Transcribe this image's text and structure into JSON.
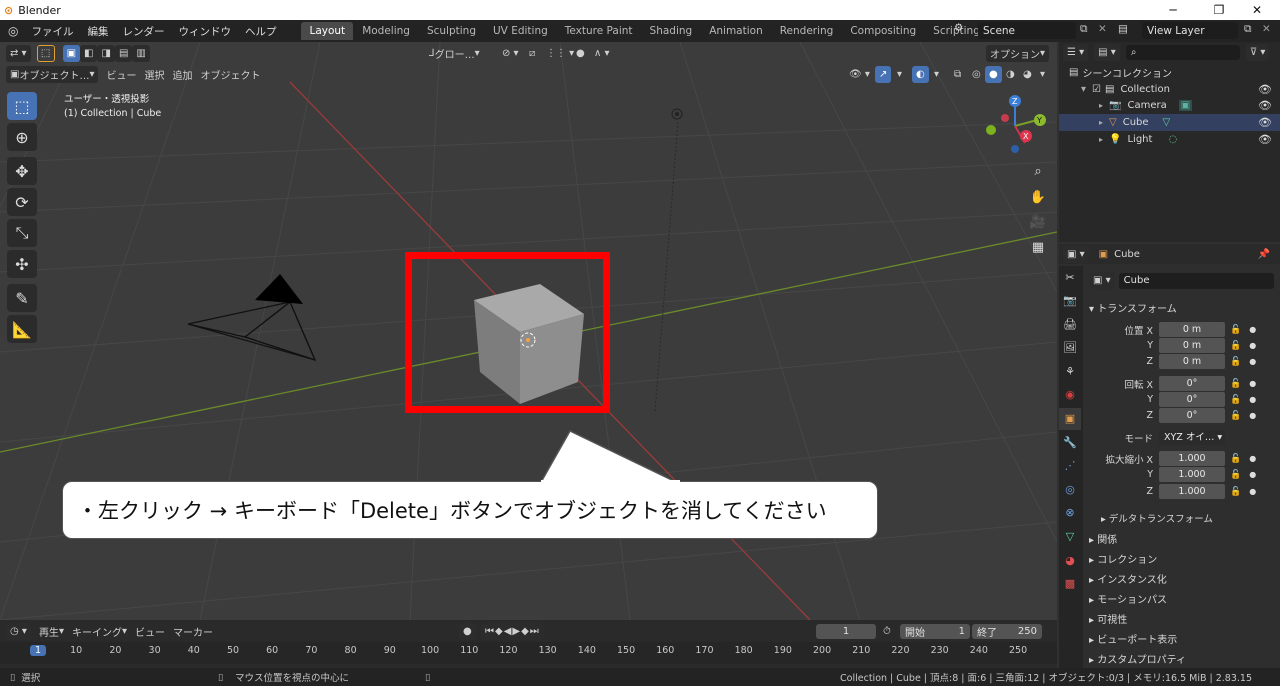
{
  "window": {
    "title": "Blender",
    "minimize": "─",
    "maximize": "❐",
    "close": "✕"
  },
  "menus": [
    "ファイル",
    "編集",
    "レンダー",
    "ウィンドウ",
    "ヘルプ"
  ],
  "workspaces": [
    "Layout",
    "Modeling",
    "Sculpting",
    "UV Editing",
    "Texture Paint",
    "Shading",
    "Animation",
    "Rendering",
    "Compositing",
    "Scripting"
  ],
  "scene": {
    "name": "Scene",
    "view_layer": "View Layer"
  },
  "viewport": {
    "transform_orientation": "グロー…",
    "options_label": "オプション",
    "mode": "オブジェクト…",
    "menu": [
      "ビュー",
      "選択",
      "追加",
      "オブジェクト"
    ],
    "view_name": "ユーザー・透視投影",
    "context": "(1) Collection | Cube",
    "gizmo_labels": {
      "z": "Z",
      "y": "Y",
      "x": "X"
    }
  },
  "callout": {
    "text": "・左クリック → キーボード「Delete」ボタンでオブジェクトを消してください"
  },
  "outliner": {
    "root": "シーンコレクション",
    "items": [
      {
        "name": "Collection"
      },
      {
        "name": "Camera"
      },
      {
        "name": "Cube"
      },
      {
        "name": "Light"
      }
    ]
  },
  "properties": {
    "object_name": "Cube",
    "datablock": "Cube",
    "transform_header": "トランスフォーム",
    "location": {
      "label": "位置 X",
      "x": "0 m",
      "y": "0 m",
      "z": "0 m"
    },
    "rotation": {
      "label": "回転 X",
      "x": "0°",
      "y": "0°",
      "z": "0°"
    },
    "mode": {
      "label": "モード",
      "value": "XYZ オイ…"
    },
    "scale": {
      "label": "拡大縮小 X",
      "x": "1.000",
      "y": "1.000",
      "z": "1.000"
    },
    "axis_y": "Y",
    "axis_z": "Z",
    "delta": "デルタトランスフォーム",
    "sections": [
      "関係",
      "コレクション",
      "インスタンス化",
      "モーションパス",
      "可視性",
      "ビューポート表示",
      "カスタムプロパティ"
    ]
  },
  "timeline": {
    "menus": [
      "再生",
      "キーイング",
      "ビュー",
      "マーカー"
    ],
    "current_frame": "1",
    "start_label": "開始",
    "start": "1",
    "end_label": "終了",
    "end": "250",
    "ticks": [
      "1",
      "10",
      "20",
      "30",
      "40",
      "50",
      "60",
      "70",
      "80",
      "90",
      "100",
      "110",
      "120",
      "130",
      "140",
      "150",
      "160",
      "170",
      "180",
      "190",
      "200",
      "210",
      "220",
      "230",
      "240",
      "250"
    ]
  },
  "status": {
    "left": "選択",
    "middle": "マウス位置を視点の中心に",
    "right": "Collection | Cube | 頂点:8 | 面:6 | 三角面:12 | オブジェクト:0/3 | メモリ:16.5 MiB | 2.83.15"
  }
}
